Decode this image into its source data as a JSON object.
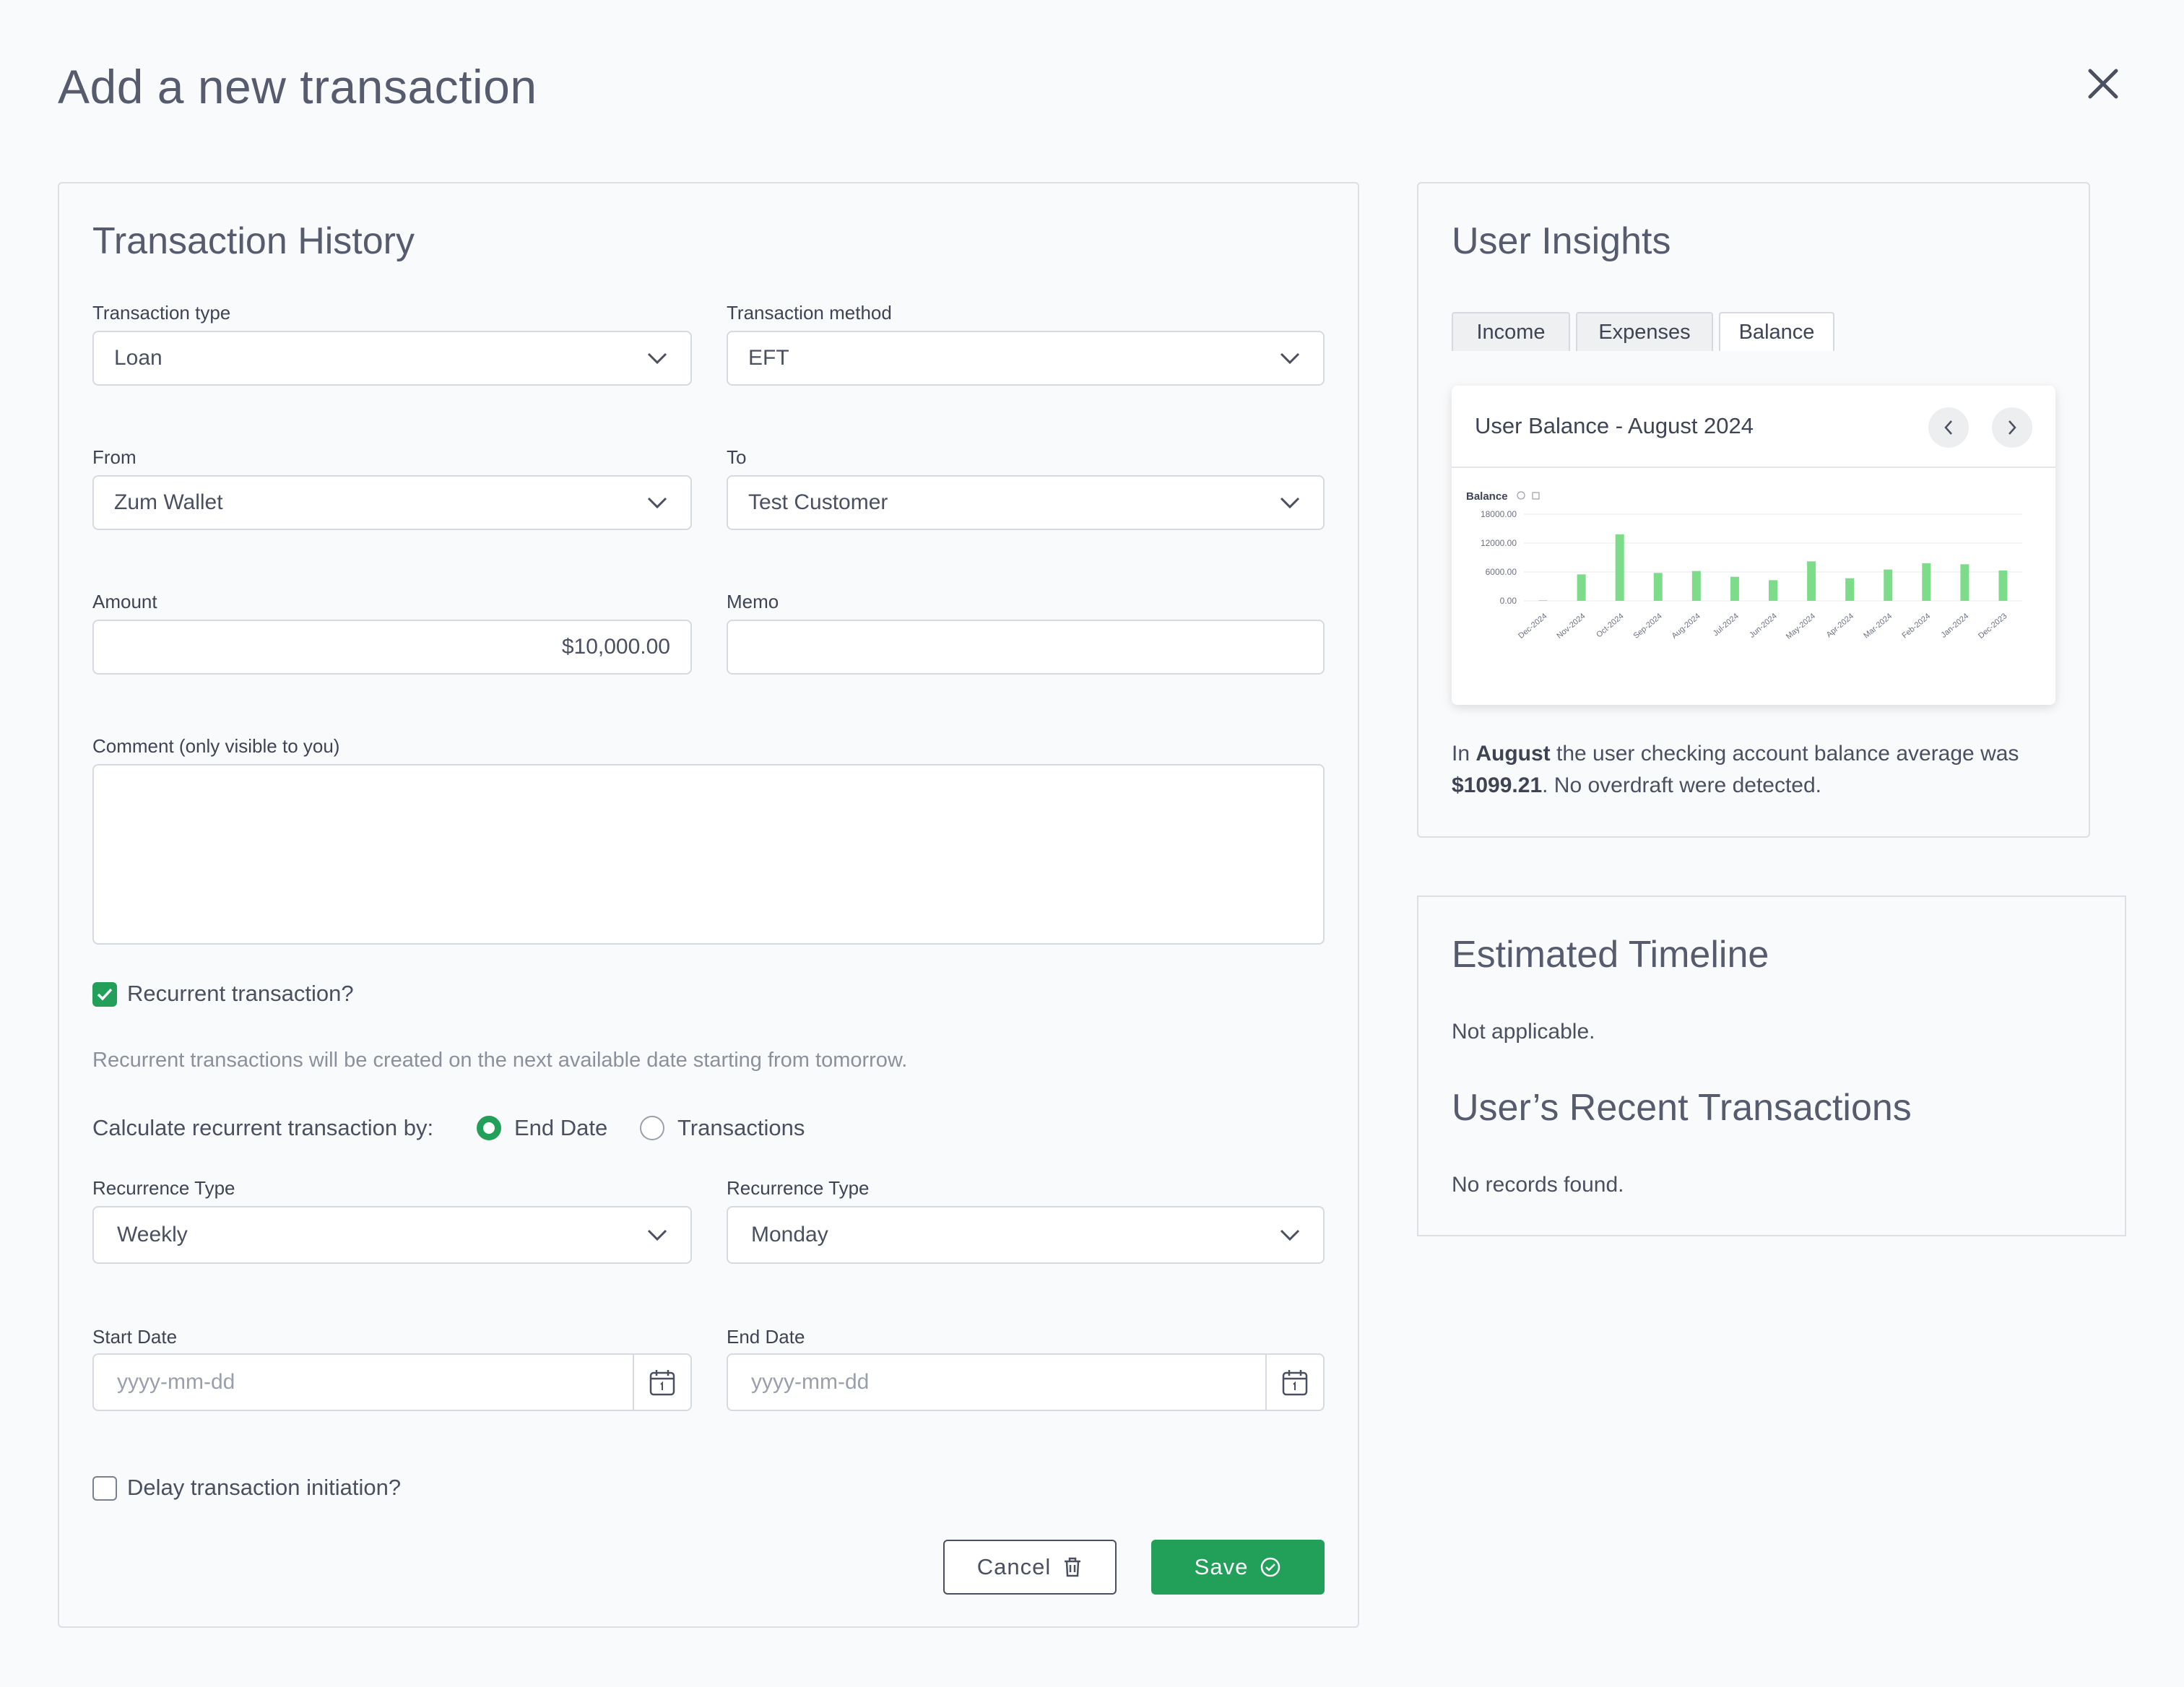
{
  "page": {
    "title": "Add a new transaction"
  },
  "form": {
    "section_title": "Transaction History",
    "transaction_type": {
      "label": "Transaction type",
      "value": "Loan"
    },
    "transaction_method": {
      "label": "Transaction method",
      "value": "EFT"
    },
    "from": {
      "label": "From",
      "value": "Zum Wallet"
    },
    "to": {
      "label": "To",
      "value": "Test Customer"
    },
    "amount": {
      "label": "Amount",
      "value": "$10,000.00"
    },
    "memo": {
      "label": "Memo",
      "value": ""
    },
    "comment": {
      "label": "Comment (only visible to you)",
      "value": ""
    },
    "recurrent": {
      "label": "Recurrent transaction?",
      "checked": true
    },
    "recurrent_hint": "Recurrent transactions will be created on the next available date starting from tomorrow.",
    "calc_by": {
      "label": "Calculate recurrent transaction by:",
      "options": [
        "End Date",
        "Transactions"
      ],
      "selected": "End Date"
    },
    "recurrence_type_1": {
      "label": "Recurrence Type",
      "value": "Weekly"
    },
    "recurrence_type_2": {
      "label": "Recurrence Type",
      "value": "Monday"
    },
    "start_date": {
      "label": "Start Date",
      "placeholder": "yyyy-mm-dd"
    },
    "end_date": {
      "label": "End Date",
      "placeholder": "yyyy-mm-dd"
    },
    "delay": {
      "label": "Delay transaction initiation?",
      "checked": false
    },
    "buttons": {
      "cancel": "Cancel",
      "save": "Save"
    }
  },
  "insights": {
    "title": "User Insights",
    "tabs": [
      "Income",
      "Expenses",
      "Balance"
    ],
    "active_tab": "Balance",
    "chart_card_title": "User Balance - August 2024",
    "summary": {
      "prefix": "In ",
      "month": "August",
      "middle": " the user checking account balance average was ",
      "amount": "$1099.21",
      "suffix": ". No overdraft were detected."
    }
  },
  "chart_data": {
    "type": "bar",
    "title": "Balance",
    "ylabel": "",
    "xlabel": "",
    "categories": [
      "Dec-2024",
      "Nov-2024",
      "Oct-2024",
      "Sep-2024",
      "Aug-2024",
      "Jul-2024",
      "Jun-2024",
      "May-2024",
      "Apr-2024",
      "Mar-2024",
      "Feb-2024",
      "Jan-2024",
      "Dec-2023"
    ],
    "values": [
      0,
      5500,
      13800,
      5800,
      6200,
      5000,
      4300,
      8200,
      4700,
      6500,
      7800,
      7600,
      6300
    ],
    "yticks": [
      "18000.00",
      "12000.00",
      "6000.00",
      "0.00"
    ],
    "ylim": [
      0,
      18000
    ],
    "grid": true,
    "bar_color": "#7ddc8a"
  },
  "timeline": {
    "title": "Estimated Timeline",
    "text": "Not applicable.",
    "recent_title": "User’s Recent Transactions",
    "recent_text": "No records found."
  },
  "colors": {
    "accent": "#22a05a",
    "text": "#4b5061"
  }
}
